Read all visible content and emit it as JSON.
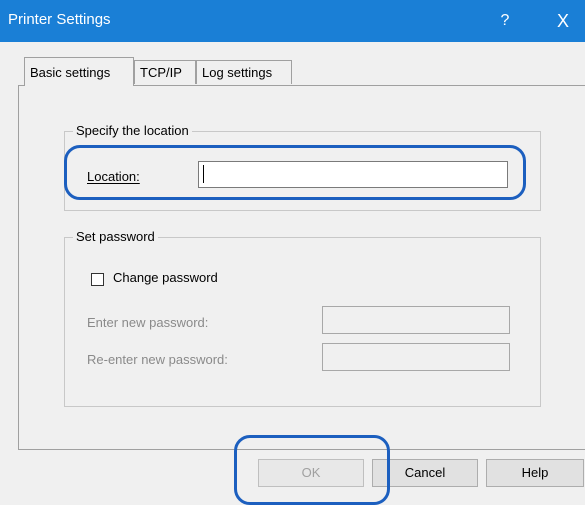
{
  "window": {
    "title": "Printer Settings",
    "help_glyph": "?",
    "close_glyph": "X"
  },
  "tabs": [
    {
      "label": "Basic settings",
      "active": true
    },
    {
      "label": "TCP/IP",
      "active": false
    },
    {
      "label": "Log settings",
      "active": false
    }
  ],
  "location_group": {
    "legend": "Specify the location",
    "location_label": "Location:",
    "location_value": ""
  },
  "password_group": {
    "legend": "Set password",
    "change_password_label": "Change password",
    "change_password_checked": false,
    "new_password_label": "Enter new password:",
    "reenter_password_label": "Re-enter new password:"
  },
  "buttons": {
    "ok": "OK",
    "cancel": "Cancel",
    "help": "Help"
  },
  "colors": {
    "titlebar": "#1a7fd6",
    "highlight": "#1c5fbf"
  }
}
